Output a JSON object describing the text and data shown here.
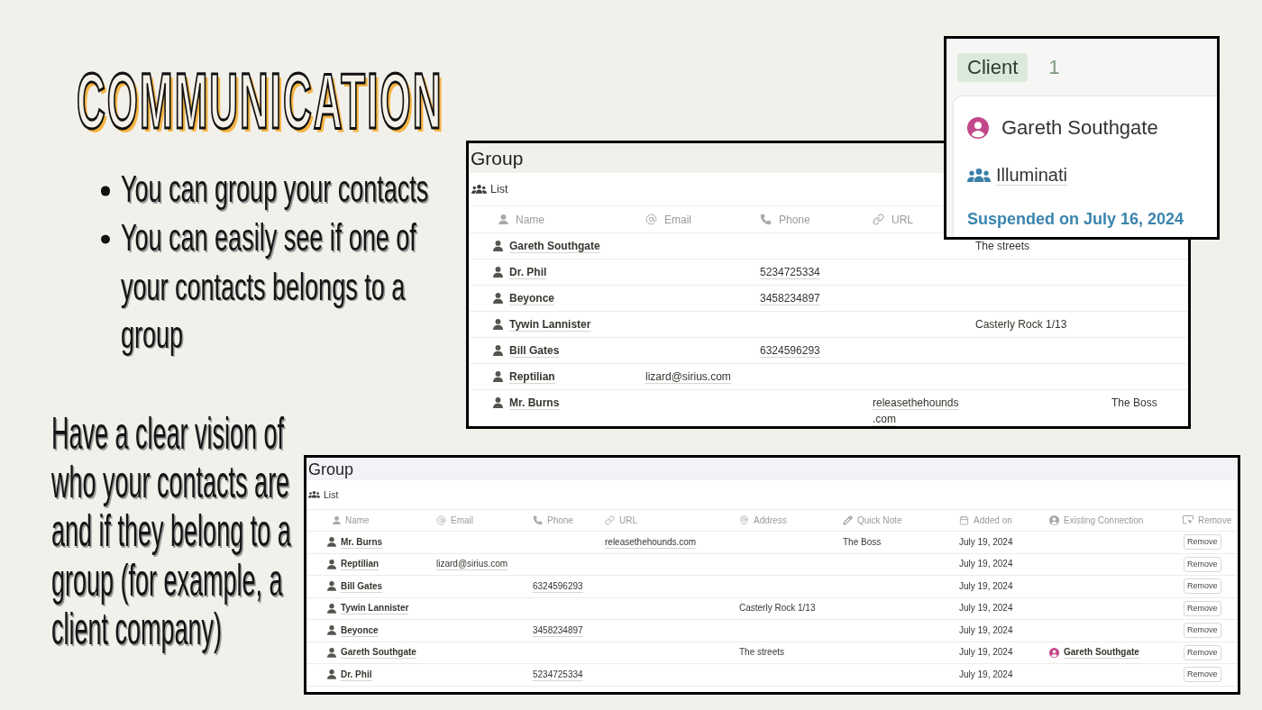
{
  "slide": {
    "title": "COMMUNICATION",
    "bullets": [
      "You can group your contacts",
      "You can easily see if one of your contacts belongs to a group"
    ],
    "note": "Have a clear vision of who your contacts are and if they belong to a group (for example, a client company)"
  },
  "top_table": {
    "title": "Group",
    "view": "List",
    "columns": [
      {
        "label": "Name",
        "kind": "person"
      },
      {
        "label": "Email",
        "kind": "at"
      },
      {
        "label": "Phone",
        "kind": "phone"
      },
      {
        "label": "URL",
        "kind": "link"
      }
    ],
    "rows": [
      {
        "name": "Gareth Southgate",
        "column_5": "The streets"
      },
      {
        "name": "Dr. Phil",
        "phone": "5234725334"
      },
      {
        "name": "Beyonce",
        "phone": "3458234897"
      },
      {
        "name": "Tywin Lannister",
        "column_5": "Casterly Rock 1/13"
      },
      {
        "name": "Bill Gates",
        "phone": "6324596293"
      },
      {
        "name": "Reptilian",
        "email": "lizard@sirius.com"
      },
      {
        "name": "Mr. Burns",
        "url": "releasethehounds.com",
        "column_6": "The Boss"
      }
    ]
  },
  "client_card": {
    "label": "Client",
    "count": "1",
    "contact": "Gareth Southgate",
    "group": "Illuminati",
    "status": "Suspended on July 16, 2024"
  },
  "bottom_table": {
    "title": "Group",
    "view": "List",
    "columns": [
      {
        "label": "Name",
        "kind": "person"
      },
      {
        "label": "Email",
        "kind": "at"
      },
      {
        "label": "Phone",
        "kind": "phone"
      },
      {
        "label": "URL",
        "kind": "link"
      },
      {
        "label": "Address",
        "kind": "pin"
      },
      {
        "label": "Quick Note",
        "kind": "pencil"
      },
      {
        "label": "Added on",
        "kind": "calendar"
      },
      {
        "label": "Existing Connection",
        "kind": "avatar"
      },
      {
        "label": "Remove",
        "kind": "cursor"
      }
    ],
    "rows": [
      {
        "name": "Mr. Burns",
        "url": "releasethehounds.com",
        "quick_note": "The Boss",
        "added_on": "July 19, 2024",
        "remove": "Remove"
      },
      {
        "name": "Reptilian",
        "email": "lizard@sirius.com",
        "added_on": "July 19, 2024",
        "remove": "Remove"
      },
      {
        "name": "Bill Gates",
        "phone": "6324596293",
        "added_on": "July 19, 2024",
        "remove": "Remove"
      },
      {
        "name": "Tywin Lannister",
        "address": "Casterly Rock 1/13",
        "added_on": "July 19, 2024",
        "remove": "Remove"
      },
      {
        "name": "Beyonce",
        "phone": "3458234897",
        "added_on": "July 19, 2024",
        "remove": "Remove"
      },
      {
        "name": "Gareth Southgate",
        "address": "The streets",
        "added_on": "July 19, 2024",
        "existing_connection": "Gareth Southgate",
        "remove": "Remove"
      },
      {
        "name": "Dr. Phil",
        "phone": "5234725334",
        "added_on": "July 19, 2024",
        "remove": "Remove"
      }
    ]
  }
}
